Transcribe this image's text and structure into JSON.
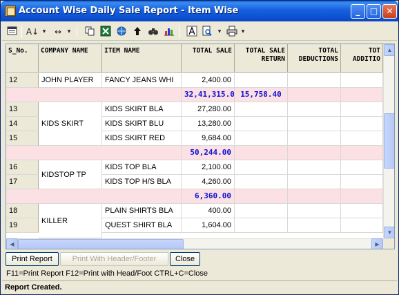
{
  "window": {
    "title": "Account Wise Daily Sale Report - Item Wise"
  },
  "title_buttons": {
    "minimize": "_",
    "maximize": "□",
    "close": "✕"
  },
  "toolbar": {
    "icons": [
      "window-icon",
      "sort-icon",
      "column-width-icon",
      "copy-icon",
      "excel-icon",
      "web-icon",
      "up-arrow-icon",
      "find-icon",
      "chart-icon",
      "font-icon",
      "print-preview-icon",
      "printer-icon"
    ],
    "sort_glyph": "A↓",
    "width_glyph": "↔",
    "dropdown_glyph": "▾"
  },
  "grid": {
    "headers": {
      "sno": "S_No.",
      "company": "COMPANY NAME",
      "item": "ITEM NAME",
      "total_sale": "TOTAL SALE",
      "total_sale_return_1": "TOTAL SALE",
      "total_sale_return_2": "RETURN",
      "total_deductions_1": "TOTAL",
      "total_deductions_2": "DEDUCTIONS",
      "total_additions_1": "TOT",
      "total_additions_2": "ADDITIO"
    },
    "rows": [
      {
        "type": "data",
        "sno": "12",
        "item": "FANCY JEANS WHI",
        "total_sale": "2,400.00"
      },
      {
        "type": "subtotal",
        "total_sale": "32,41,315.0",
        "return": "15,758.40"
      },
      {
        "type": "data",
        "sno": "13",
        "item": "KIDS SKIRT BLA",
        "total_sale": "27,280.00"
      },
      {
        "type": "data",
        "sno": "14",
        "item": "KIDS SKIRT BLU",
        "total_sale": "13,280.00"
      },
      {
        "type": "data",
        "sno": "15",
        "item": "KIDS SKIRT RED",
        "total_sale": "9,684.00"
      },
      {
        "type": "subtotal",
        "total_sale": "50,244.00",
        "return": ""
      },
      {
        "type": "data",
        "sno": "16",
        "item": "KIDS TOP BLA",
        "total_sale": "2,100.00"
      },
      {
        "type": "data",
        "sno": "17",
        "item": "KIDS TOP H/S BLA",
        "total_sale": "4,260.00"
      },
      {
        "type": "subtotal",
        "total_sale": "6,360.00",
        "return": ""
      },
      {
        "type": "data",
        "sno": "18",
        "item": "PLAIN SHIRTS BLA",
        "total_sale": "400.00"
      },
      {
        "type": "data",
        "sno": "19",
        "item": "QUEST SHIRT BLA",
        "total_sale": "1,604.00"
      }
    ],
    "companies": [
      "JOHN PLAYER",
      "KIDS SKIRT",
      "KIDSTOP TP",
      "KILLER"
    ],
    "scroll": {
      "up": "▲",
      "down": "▼",
      "left": "◀",
      "right": "▶"
    }
  },
  "buttons": {
    "print_report": "Print Report",
    "print_header_footer": "Print With Header/Footer",
    "close": "Close"
  },
  "hint": "F11=Print Report  F12=Print with Head/Foot  CTRL+C=Close",
  "status": "Report Created."
}
